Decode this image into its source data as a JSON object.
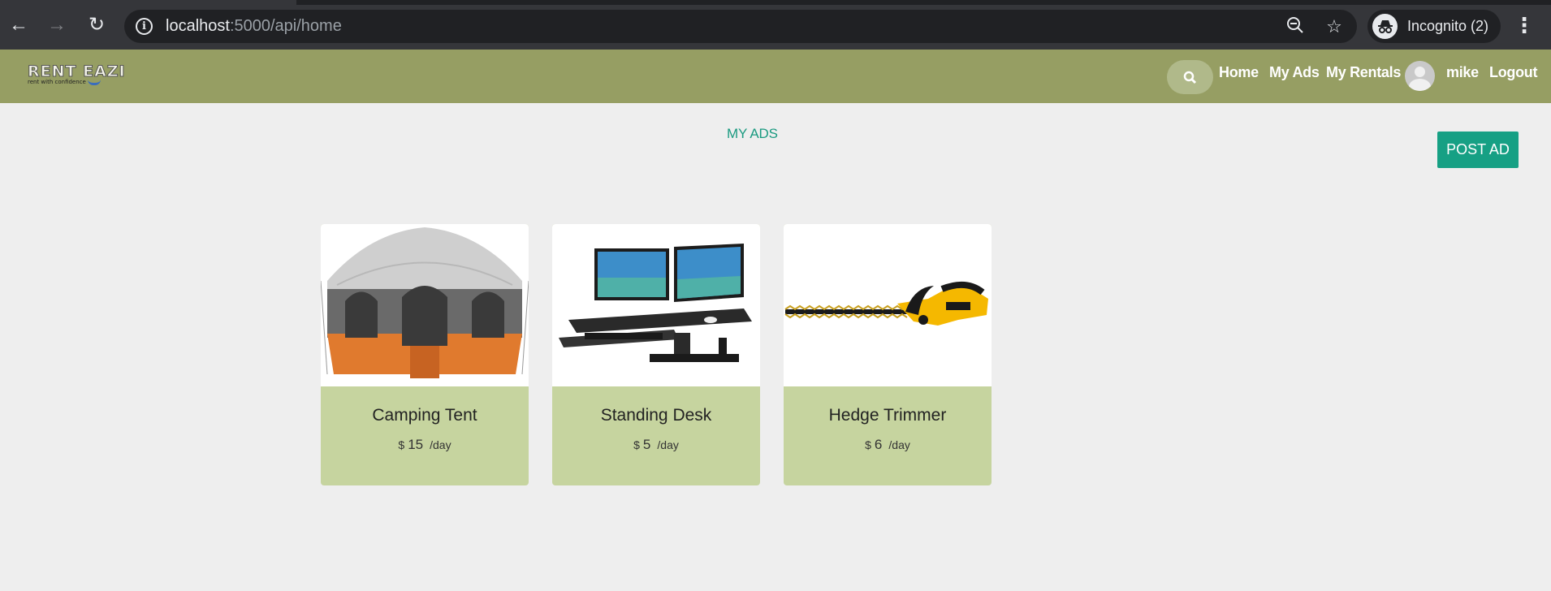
{
  "browser": {
    "url_host": "localhost",
    "url_rest": ":5000/api/home",
    "incognito_label": "Incognito (2)"
  },
  "navbar": {
    "logo_title": "RENT EAZI",
    "logo_tagline": "rent with confidence",
    "links": [
      "Home",
      "My Ads",
      "My Rentals"
    ],
    "username": "mike",
    "logout_label": "Logout"
  },
  "page": {
    "title": "MY ADS",
    "post_ad_label": "POST AD"
  },
  "ads": [
    {
      "name": "Camping Tent",
      "currency": "$",
      "price": "15",
      "period": "/day",
      "image_icon": "tent-image"
    },
    {
      "name": "Standing Desk",
      "currency": "$",
      "price": "5",
      "period": "/day",
      "image_icon": "desk-image"
    },
    {
      "name": "Hedge Trimmer",
      "currency": "$",
      "price": "6",
      "period": "/day",
      "image_icon": "trimmer-image"
    }
  ],
  "colors": {
    "navbar": "#969e63",
    "accent": "#16a084",
    "card_footer": "#c6d49f",
    "background": "#eeeeee"
  }
}
